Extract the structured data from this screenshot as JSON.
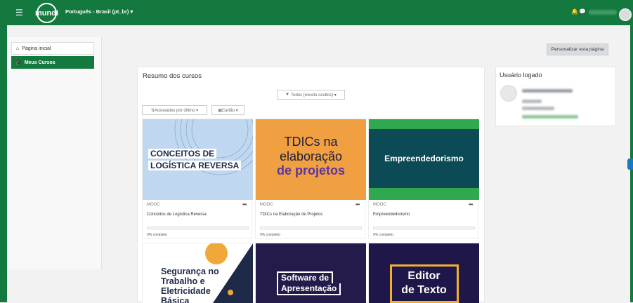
{
  "header": {
    "menu_icon": "hamburger-icon",
    "logo_text": "mundi",
    "language": "Português - Brasil (pt_br) ▾",
    "notification_icon": "bell-icon",
    "message_icon": "chat-icon"
  },
  "sidebar": {
    "items": [
      {
        "label": "Página inicial",
        "icon": "home-icon"
      },
      {
        "label": "Meus Cursos",
        "icon": "courses-icon"
      }
    ]
  },
  "page": {
    "customize_button": "Personalizar esta página"
  },
  "courses": {
    "title": "Resumo dos cursos",
    "filter": "Todos (exceto ocultos) ▾",
    "sort": "Acessados por último ▾",
    "view": "Cartão ▾",
    "cards": [
      {
        "category": "MOOC",
        "name": "Conceitos de Logística Reversa",
        "progress": "0% completo",
        "progress_value": 0,
        "image_text": [
          "CONCEITOS DE",
          "LOGÍSTICA REVERSA"
        ]
      },
      {
        "category": "MOOC",
        "name": "TDICs na Elaboração de Projetos",
        "progress": "0% completo",
        "progress_value": 0,
        "image_text": [
          "TDICs na",
          "elaboração",
          "de projetos"
        ]
      },
      {
        "category": "MOOC",
        "name": "Empreendedorismo",
        "progress": "0% completo",
        "progress_value": 0,
        "image_text": [
          "Empreendedorismo"
        ]
      },
      {
        "image_text": [
          "Segurança no",
          "Trabalho e",
          "Eletricidade",
          "Básica"
        ]
      },
      {
        "image_text": [
          "Software de",
          "Apresentação"
        ]
      },
      {
        "image_text": [
          "Editor",
          "de Texto"
        ]
      }
    ]
  },
  "right_block": {
    "title": "Usuário logado"
  },
  "colors": {
    "brand_green": "#13793f",
    "accent_blue": "#1a79c3"
  }
}
